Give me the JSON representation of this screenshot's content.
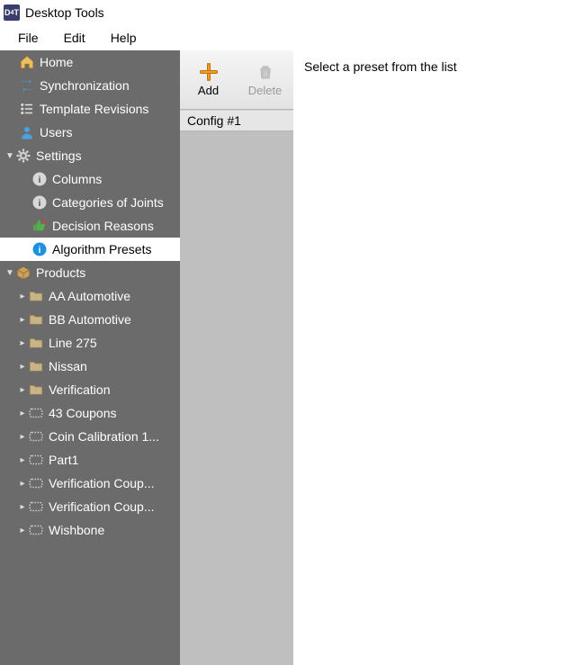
{
  "window": {
    "title": "Desktop Tools"
  },
  "menubar": {
    "file": "File",
    "edit": "Edit",
    "help": "Help"
  },
  "sidebar": {
    "home": "Home",
    "sync": "Synchronization",
    "template_revisions": "Template Revisions",
    "users": "Users",
    "settings": "Settings",
    "settings_items": {
      "columns": "Columns",
      "categories": "Categories of Joints",
      "decision_reasons": "Decision Reasons",
      "algorithm_presets": "Algorithm Presets"
    },
    "products": "Products",
    "product_items": [
      "AA Automotive",
      "BB Automotive",
      "Line 275",
      "Nissan",
      "Verification",
      "43 Coupons",
      "Coin Calibration 1...",
      "Part1",
      "Verification Coup...",
      "Verification Coup...",
      "Wishbone"
    ]
  },
  "toolbar": {
    "add": "Add",
    "delete": "Delete"
  },
  "presets": {
    "items": [
      "Config #1"
    ]
  },
  "detail": {
    "placeholder": "Select a preset from the list"
  },
  "icons": {
    "caret_expanded": "▼",
    "caret_collapsed": "▸"
  }
}
